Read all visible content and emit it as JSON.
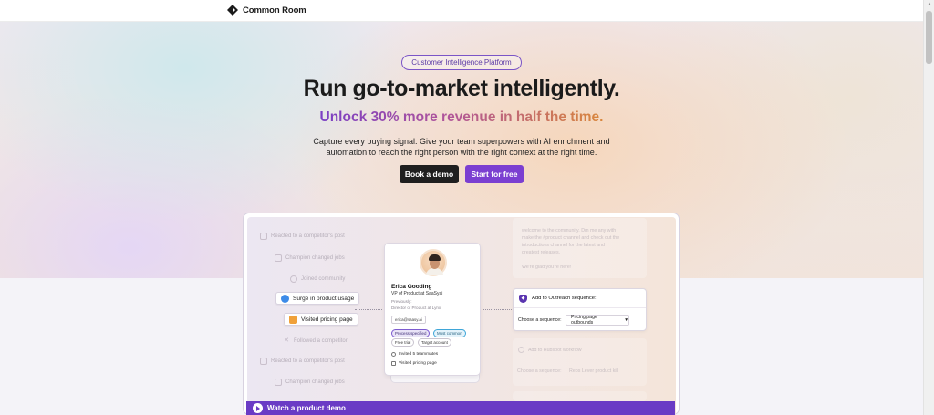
{
  "brand": {
    "name": "Common Room"
  },
  "hero": {
    "badge": "Customer Intelligence Platform",
    "headline": "Run go-to-market intelligently.",
    "subheadline": "Unlock 30% more revenue in half the time.",
    "description_line1": "Capture every buying signal. Give your team superpowers with AI enrichment and",
    "description_line2": "automation to reach the right person with the right context at the right time.",
    "buttons": {
      "demo": "Book a demo",
      "free": "Start for free"
    }
  },
  "demo": {
    "signals": [
      {
        "label": "Reacted to a competitor's post",
        "active": false,
        "icon": "grid-icon"
      },
      {
        "label": "Champion changed jobs",
        "active": false,
        "icon": "grid-icon"
      },
      {
        "label": "Joined community",
        "active": false,
        "icon": "sparkle-icon"
      },
      {
        "label": "Surge in product usage",
        "active": true,
        "icon": "globe-icon",
        "icon_color": "#3d8be8"
      },
      {
        "label": "Visited pricing page",
        "active": true,
        "icon": "flame-icon",
        "icon_color": "#f0a13a"
      },
      {
        "label": "Followed a competitor",
        "active": false,
        "icon": "x-icon"
      },
      {
        "label": "Reacted to a competitor's post",
        "active": false,
        "icon": "grid-icon"
      },
      {
        "label": "Champion changed jobs",
        "active": false,
        "icon": "grid-icon"
      }
    ],
    "profile": {
      "name": "Erica Gooding",
      "title": "VP of Product at SaaSyai",
      "previously_label": "Previously:",
      "previous_role": "Director of Product at Lynx",
      "email": "erica@saasy.ai",
      "tags": [
        {
          "label": "Process specified",
          "bg": "#e9e4f7",
          "border": "#7d5bd0",
          "color": "#3d2c75"
        },
        {
          "label": "Most common",
          "bg": "#e4f3fb",
          "border": "#3fa6d8",
          "color": "#1f5e7d"
        },
        {
          "label": "Free trial",
          "bg": "#ffffff",
          "border": "#c9c4cf",
          "color": "#333333"
        },
        {
          "label": "Target account",
          "bg": "#ffffff",
          "border": "#c9c4cf",
          "color": "#333333"
        }
      ],
      "activity": [
        "Invited 5 teammates",
        "Visited pricing page"
      ]
    },
    "right_ghost_lines": [
      "welcome to the community. Dm me any with",
      "make the #product channel and check out the",
      "introductions channel for the latest and",
      "greatest releases.",
      "",
      "We're glad you're here!"
    ],
    "outreach": {
      "title": "Add to Outreach sequence:",
      "sequence_label": "Choose a sequence:",
      "sequence_value": "Pricing page outbounds"
    },
    "workflow_ghost": {
      "title": "Add to Hubspot workflow",
      "label": "Choose a sequence:",
      "value": "Reps Lever product kill"
    },
    "watch_label": "Watch a product demo"
  }
}
